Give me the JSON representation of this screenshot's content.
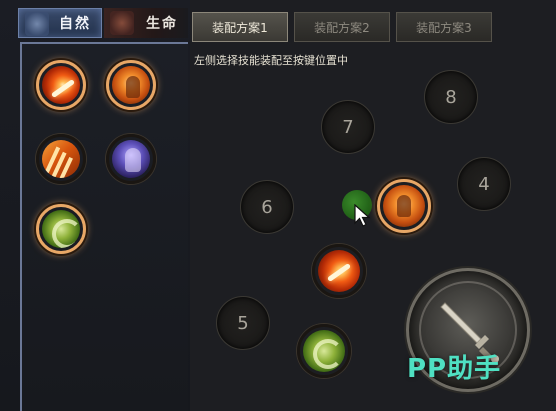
{
  "categories": [
    {
      "label": "自然",
      "active": true
    },
    {
      "label": "生命",
      "active": false
    }
  ],
  "plans": [
    {
      "label": "装配方案1",
      "active": true
    },
    {
      "label": "装配方案2",
      "active": false
    },
    {
      "label": "装配方案3",
      "active": false
    }
  ],
  "instruction": "左侧选择技能装配至按键位置中",
  "skill_list": [
    {
      "icon": "fire-burst-skill-icon",
      "equipped": true
    },
    {
      "icon": "fire-figure-skill-icon",
      "equipped": true
    },
    {
      "icon": "fire-claw-skill-icon",
      "equipped": false
    },
    {
      "icon": "ghost-skill-icon",
      "equipped": false
    },
    {
      "icon": "green-dragon-skill-icon",
      "equipped": true
    }
  ],
  "slots": [
    {
      "key": "8"
    },
    {
      "key": "7"
    },
    {
      "key": "6"
    },
    {
      "key": "5"
    },
    {
      "key": "4"
    }
  ],
  "equipped_slot_skills": [
    "fire-figure-skill-icon",
    "fire-burst-skill-icon",
    "green-dragon-skill-icon"
  ],
  "attack_button_icon": "sword-icon",
  "watermark": "PP助手",
  "colors": {
    "equipped_ring": "#e8a766",
    "active_tab": "#394a6a",
    "watermark": "#4fe0c2"
  }
}
